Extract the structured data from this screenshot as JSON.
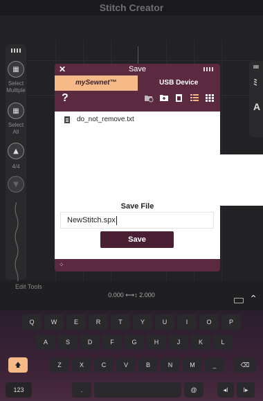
{
  "app": {
    "title": "Stitch Creator"
  },
  "left_panel": {
    "select_multiple_label": "Select Mulitple",
    "select_all_label": "Select All",
    "page_indicator": "4/4"
  },
  "dialog": {
    "title": "Save",
    "tabs": [
      {
        "label": "mySewnet™",
        "active": true
      },
      {
        "label": "USB Device",
        "active": false
      }
    ],
    "help_label": "?",
    "files": [
      {
        "name": "do_not_remove.txt"
      }
    ],
    "save_section": {
      "heading": "Save File",
      "filename_value": "NewStitch.spx",
      "save_button": "Save"
    }
  },
  "edit_tools": {
    "label": "Edit Tools",
    "coords": {
      "x": "0.000",
      "y": "2.000"
    }
  },
  "keyboard": {
    "row1": [
      "Q",
      "W",
      "E",
      "R",
      "T",
      "Y",
      "U",
      "I",
      "O",
      "P"
    ],
    "row2": [
      "A",
      "S",
      "D",
      "F",
      "G",
      "H",
      "J",
      "K",
      "L"
    ],
    "row3": [
      "Z",
      "X",
      "C",
      "V",
      "B",
      "N",
      "M",
      "_"
    ],
    "numbers_key": "123",
    "dot_key": ".",
    "at_key": "@"
  },
  "colors": {
    "accent": "#f6b988",
    "dialog_bg": "#5c2a40",
    "button_bg": "#4a1f33"
  }
}
